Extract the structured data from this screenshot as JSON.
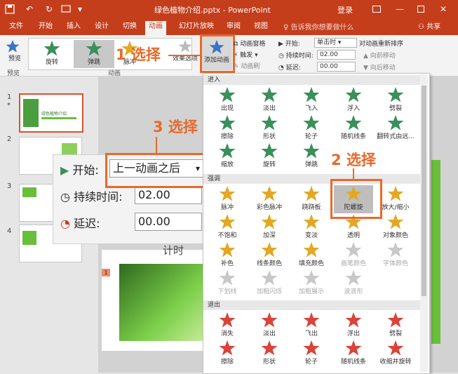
{
  "titlebar": {
    "title": "绿色植物介绍.pptx - PowerPoint",
    "login": "登录",
    "colors": {
      "bar": "#c43e1c",
      "accent": "#e8692a"
    }
  },
  "tabs": [
    "文件",
    "开始",
    "插入",
    "设计",
    "切换",
    "动画",
    "幻灯片放映",
    "审阅",
    "视图"
  ],
  "active_tab": "动画",
  "tellme": "告诉我你想要做什么",
  "share": "共享",
  "ribbon": {
    "preview": "预览",
    "preview_group": "预览",
    "animation_group": "动画",
    "gallery": [
      "旋转",
      "弹跳",
      "脉冲"
    ],
    "effect_options": "效果选项",
    "add_animation": "添加动画",
    "anim_pane": "动画窗格",
    "trigger": "触发",
    "anim_painter": "动画刷",
    "start_label": "开始:",
    "start_value": "单击时",
    "duration_label": "持续时间:",
    "duration_value": "02.00",
    "delay_label": "延迟:",
    "delay_value": "00.00",
    "reorder": "对动画重新排序",
    "move_earlier": "向前移动",
    "move_later": "向后移动"
  },
  "slides": [
    {
      "num": "1",
      "title": "绿色植物介绍",
      "star": "*"
    },
    {
      "num": "2"
    },
    {
      "num": "3"
    },
    {
      "num": "4"
    }
  ],
  "callout": {
    "start_label": "开始:",
    "start_value": "上一动画之后",
    "duration_label": "持续时间:",
    "duration_value": "02.00",
    "delay_label": "延迟:",
    "delay_value": "00.00",
    "timing": "计时"
  },
  "steps": {
    "s1": "1 选择",
    "s2": "2 选择",
    "s3": "3 选择"
  },
  "slide_marker": "1",
  "dropdown": {
    "entrance_header": "进入",
    "entrance": [
      "出现",
      "淡出",
      "飞入",
      "浮入",
      "劈裂",
      "擦除",
      "形状",
      "轮子",
      "随机线条",
      "翻转式由远...",
      "缩放",
      "旋转",
      "弹跳"
    ],
    "emphasis_header": "强调",
    "emphasis": [
      "脉冲",
      "彩色脉冲",
      "跷跷板",
      "陀螺旋",
      "放大/缩小",
      "不饱和",
      "加深",
      "变淡",
      "透明",
      "对象颜色",
      "补色",
      "线条颜色",
      "填充颜色",
      "画笔颜色",
      "字体颜色",
      "下划线",
      "加粗闪烁",
      "加粗展示",
      "波浪形"
    ],
    "emphasis_gray": [
      "画笔颜色",
      "字体颜色",
      "下划线",
      "加粗闪烁",
      "加粗展示",
      "波浪形"
    ],
    "exit_header": "退出",
    "exit": [
      "消失",
      "淡出",
      "飞出",
      "浮出",
      "劈裂",
      "擦除",
      "形状",
      "轮子",
      "随机线条",
      "收缩并旋转"
    ]
  }
}
